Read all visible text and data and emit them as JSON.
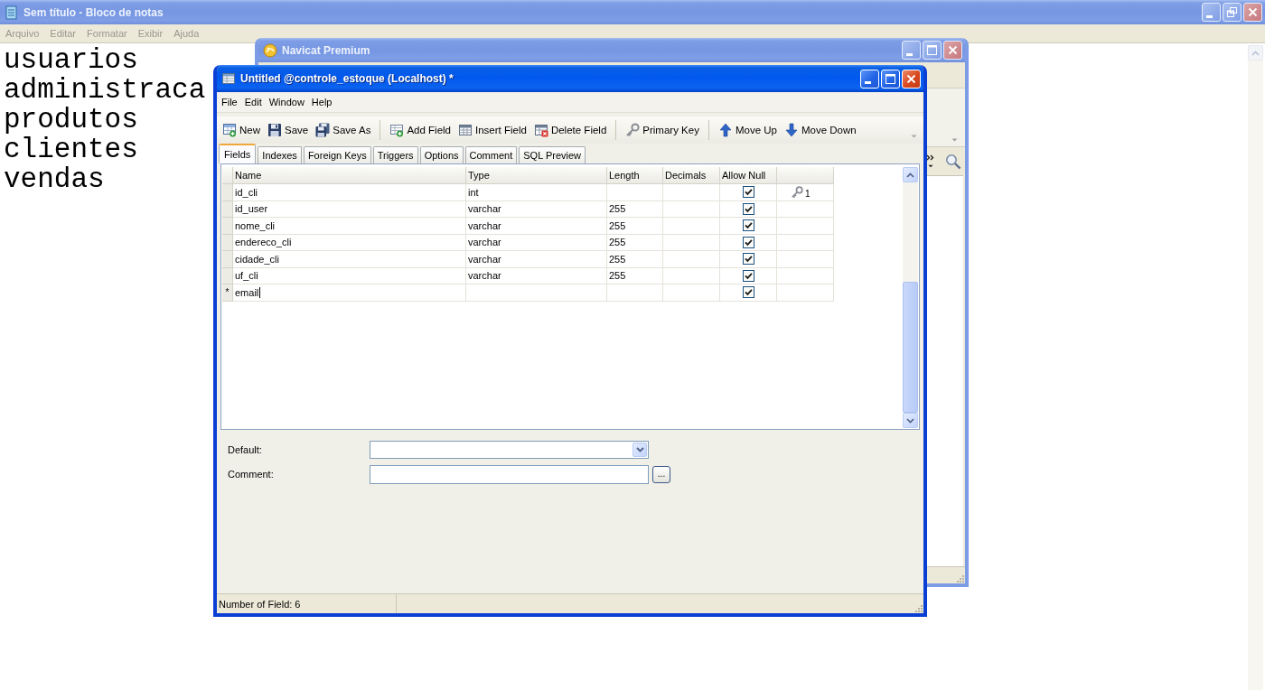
{
  "notepad": {
    "title": "Sem título - Bloco de notas",
    "active": false,
    "menu": [
      "Arquivo",
      "Editar",
      "Formatar",
      "Exibir",
      "Ajuda"
    ],
    "lines": [
      "usuarios",
      "administraca",
      "produtos",
      "clientes",
      "vendas"
    ]
  },
  "navicat_window": {
    "title": "Navicat Premium",
    "active": false
  },
  "table_window": {
    "title": "Untitled @controle_estoque (Localhost) *",
    "active": true,
    "menu": [
      "File",
      "Edit",
      "Window",
      "Help"
    ],
    "toolbar": [
      [
        {
          "label": "New",
          "kind": "new"
        },
        {
          "label": "Save",
          "kind": "save"
        },
        {
          "label": "Save As",
          "kind": "save_as"
        }
      ],
      [
        {
          "label": "Add Field",
          "kind": "add_field"
        },
        {
          "label": "Insert Field",
          "kind": "insert_field"
        },
        {
          "label": "Delete Field",
          "kind": "delete_field"
        }
      ],
      [
        {
          "label": "Primary Key",
          "kind": "primary_key"
        }
      ],
      [
        {
          "label": "Move Up",
          "kind": "move_up"
        },
        {
          "label": "Move Down",
          "kind": "move_down"
        }
      ]
    ],
    "tabs": [
      {
        "label": "Fields",
        "selected": true
      },
      {
        "label": "Indexes",
        "selected": false
      },
      {
        "label": "Foreign Keys",
        "selected": false
      },
      {
        "label": "Triggers",
        "selected": false
      },
      {
        "label": "Options",
        "selected": false
      },
      {
        "label": "Comment",
        "selected": false
      },
      {
        "label": "SQL Preview",
        "selected": false
      }
    ],
    "grid": {
      "columns": [
        "Name",
        "Type",
        "Length",
        "Decimals",
        "Allow Null"
      ],
      "rows": [
        {
          "name": "id_cli",
          "type": "int",
          "allow_null": true,
          "key": "1",
          "editing": false
        },
        {
          "name": "id_user",
          "type": "varchar",
          "length": "255",
          "allow_null": true,
          "editing": false
        },
        {
          "name": "nome_cli",
          "type": "varchar",
          "length": "255",
          "allow_null": true,
          "editing": false
        },
        {
          "name": "endereco_cli",
          "type": "varchar",
          "length": "255",
          "allow_null": true,
          "editing": false
        },
        {
          "name": "cidade_cli",
          "type": "varchar",
          "length": "255",
          "allow_null": true,
          "editing": false
        },
        {
          "name": "uf_cli",
          "type": "varchar",
          "length": "255",
          "allow_null": true,
          "editing": false
        },
        {
          "marker": "*",
          "name": "email",
          "allow_null": true,
          "editing": true
        }
      ]
    },
    "form": {
      "default_label": "Default:",
      "comment_label": "Comment:",
      "browse_button": "..."
    },
    "status_bar": "Number of Field: 6"
  }
}
